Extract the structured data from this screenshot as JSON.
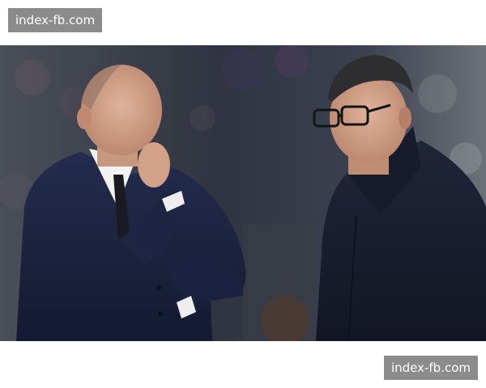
{
  "watermark_top": "index-fb.com",
  "watermark_bottom": "index-fb.com",
  "photo": {
    "subject": "two men in dark navy coats talking at a stadium at night",
    "colors": {
      "background_crowd": "#3a3f4a",
      "coat_left": "#1c2440",
      "coat_right": "#1b2233",
      "skin": "#d6a58c",
      "shirt": "#f2f2f2",
      "hair_right": "#2e2e30"
    }
  }
}
